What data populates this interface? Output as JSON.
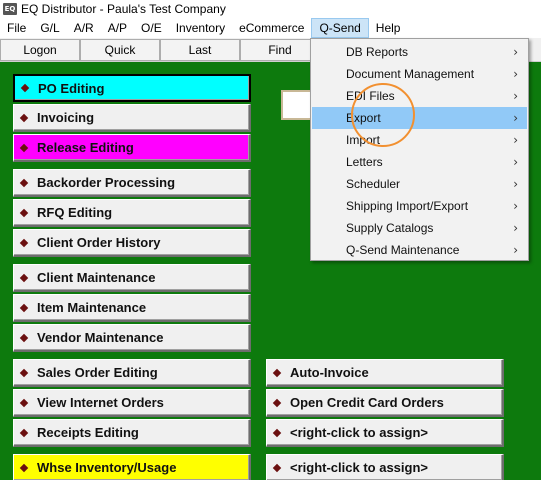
{
  "window": {
    "title": "EQ Distributor - Paula's Test Company",
    "icon_label": "EQ"
  },
  "menubar": [
    "File",
    "G/L",
    "A/R",
    "A/P",
    "O/E",
    "Inventory",
    "eCommerce",
    "Q-Send",
    "Help"
  ],
  "toolbar": [
    "Logon",
    "Quick",
    "Last",
    "Find"
  ],
  "left_buttons": [
    "PO Editing",
    "Invoicing",
    "Release Editing",
    "Backorder Processing",
    "RFQ Editing",
    "Client Order History",
    "Client Maintenance",
    "Item Maintenance",
    "Vendor Maintenance",
    "Sales Order Editing",
    "View Internet Orders",
    "Receipts Editing",
    "Whse Inventory/Usage"
  ],
  "right_buttons": [
    "Auto-Invoice",
    "Open Credit Card Orders",
    "<right-click to assign>",
    "<right-click to assign>"
  ],
  "qsend_menu": [
    "DB Reports",
    "Document Management",
    "EDI Files",
    "Export",
    "Import",
    "Letters",
    "Scheduler",
    "Shipping Import/Export",
    "Supply Catalogs",
    "Q-Send Maintenance"
  ],
  "submenu_arrow": "›",
  "colors": {
    "background": "#0d7a0d",
    "po_editing": "#00ffff",
    "release_editing": "#ff00ff",
    "whse_inventory": "#ffff00",
    "highlight": "#91c9f7",
    "annotation_circle": "#f29030"
  },
  "highlighted_menu_item": "Export"
}
